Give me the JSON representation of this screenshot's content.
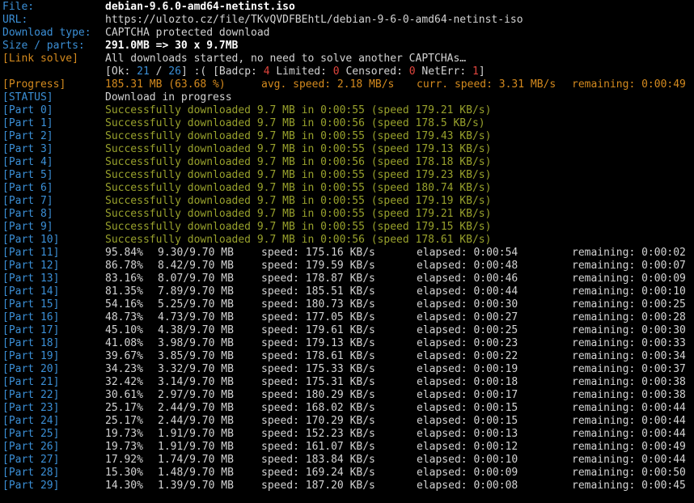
{
  "info": {
    "file_label": "File:",
    "file_value": "debian-9.6.0-amd64-netinst.iso",
    "url_label": "URL:",
    "url_value": "https://ulozto.cz/file/TKvQVDFBEhtL/debian-9-6-0-amd64-netinst-iso",
    "type_label": "Download type:",
    "type_value": "CAPTCHA protected download",
    "size_label": "Size / parts:",
    "size_value": "291.0MB => 30 x 9.7MB",
    "link_label": "[Link solve]",
    "link_value": "All downloads started, no need to solve another CAPTCHAs…"
  },
  "stats": {
    "open": "[Ok: ",
    "ok": "21",
    "slash": " / ",
    "total": "26",
    "sad": "] :( [Badcp: ",
    "badcp": "4",
    "limited_label": " Limited: ",
    "limited": "0",
    "censored_label": " Censored: ",
    "censored": "0",
    "neterr_label": " NetErr: ",
    "neterr": "1",
    "close": "]"
  },
  "progress": {
    "label": "[Progress]",
    "amount": "185.31 MB (63.68 %)",
    "avg": "avg. speed: 2.18 MB/s",
    "curr": "curr. speed: 3.31 MB/s",
    "remaining": "remaining: 0:00:49"
  },
  "status": {
    "label": "[STATUS]",
    "value": "Download in progress"
  },
  "done_parts": [
    {
      "label": "[Part 0]",
      "text": "Successfully downloaded 9.7 MB in 0:00:55 (speed 179.21 KB/s)"
    },
    {
      "label": "[Part 1]",
      "text": "Successfully downloaded 9.7 MB in 0:00:56 (speed 178.5 KB/s)"
    },
    {
      "label": "[Part 2]",
      "text": "Successfully downloaded 9.7 MB in 0:00:55 (speed 179.43 KB/s)"
    },
    {
      "label": "[Part 3]",
      "text": "Successfully downloaded 9.7 MB in 0:00:55 (speed 179.13 KB/s)"
    },
    {
      "label": "[Part 4]",
      "text": "Successfully downloaded 9.7 MB in 0:00:56 (speed 178.18 KB/s)"
    },
    {
      "label": "[Part 5]",
      "text": "Successfully downloaded 9.7 MB in 0:00:55 (speed 179.23 KB/s)"
    },
    {
      "label": "[Part 6]",
      "text": "Successfully downloaded 9.7 MB in 0:00:55 (speed 180.74 KB/s)"
    },
    {
      "label": "[Part 7]",
      "text": "Successfully downloaded 9.7 MB in 0:00:55 (speed 179.19 KB/s)"
    },
    {
      "label": "[Part 8]",
      "text": "Successfully downloaded 9.7 MB in 0:00:55 (speed 179.21 KB/s)"
    },
    {
      "label": "[Part 9]",
      "text": "Successfully downloaded 9.7 MB in 0:00:55 (speed 179.15 KB/s)"
    },
    {
      "label": "[Part 10]",
      "text": "Successfully downloaded 9.7 MB in 0:00:56 (speed 178.61 KB/s)"
    }
  ],
  "active_parts": [
    {
      "label": "[Part 11]",
      "pct": "95.84%",
      "size": "9.30/9.70 MB",
      "speed": "speed: 175.16 KB/s",
      "elapsed": "elapsed: 0:00:54",
      "remaining": "remaining: 0:00:02"
    },
    {
      "label": "[Part 12]",
      "pct": "86.78%",
      "size": "8.42/9.70 MB",
      "speed": "speed: 179.59 KB/s",
      "elapsed": "elapsed: 0:00:48",
      "remaining": "remaining: 0:00:07"
    },
    {
      "label": "[Part 13]",
      "pct": "83.16%",
      "size": "8.07/9.70 MB",
      "speed": "speed: 178.87 KB/s",
      "elapsed": "elapsed: 0:00:46",
      "remaining": "remaining: 0:00:09"
    },
    {
      "label": "[Part 14]",
      "pct": "81.35%",
      "size": "7.89/9.70 MB",
      "speed": "speed: 185.51 KB/s",
      "elapsed": "elapsed: 0:00:44",
      "remaining": "remaining: 0:00:10"
    },
    {
      "label": "[Part 15]",
      "pct": "54.16%",
      "size": "5.25/9.70 MB",
      "speed": "speed: 180.73 KB/s",
      "elapsed": "elapsed: 0:00:30",
      "remaining": "remaining: 0:00:25"
    },
    {
      "label": "[Part 16]",
      "pct": "48.73%",
      "size": "4.73/9.70 MB",
      "speed": "speed: 177.05 KB/s",
      "elapsed": "elapsed: 0:00:27",
      "remaining": "remaining: 0:00:28"
    },
    {
      "label": "[Part 17]",
      "pct": "45.10%",
      "size": "4.38/9.70 MB",
      "speed": "speed: 179.61 KB/s",
      "elapsed": "elapsed: 0:00:25",
      "remaining": "remaining: 0:00:30"
    },
    {
      "label": "[Part 18]",
      "pct": "41.08%",
      "size": "3.98/9.70 MB",
      "speed": "speed: 179.13 KB/s",
      "elapsed": "elapsed: 0:00:23",
      "remaining": "remaining: 0:00:33"
    },
    {
      "label": "[Part 19]",
      "pct": "39.67%",
      "size": "3.85/9.70 MB",
      "speed": "speed: 178.61 KB/s",
      "elapsed": "elapsed: 0:00:22",
      "remaining": "remaining: 0:00:34"
    },
    {
      "label": "[Part 20]",
      "pct": "34.23%",
      "size": "3.32/9.70 MB",
      "speed": "speed: 175.33 KB/s",
      "elapsed": "elapsed: 0:00:19",
      "remaining": "remaining: 0:00:37"
    },
    {
      "label": "[Part 21]",
      "pct": "32.42%",
      "size": "3.14/9.70 MB",
      "speed": "speed: 175.31 KB/s",
      "elapsed": "elapsed: 0:00:18",
      "remaining": "remaining: 0:00:38"
    },
    {
      "label": "[Part 22]",
      "pct": "30.61%",
      "size": "2.97/9.70 MB",
      "speed": "speed: 180.29 KB/s",
      "elapsed": "elapsed: 0:00:17",
      "remaining": "remaining: 0:00:38"
    },
    {
      "label": "[Part 23]",
      "pct": "25.17%",
      "size": "2.44/9.70 MB",
      "speed": "speed: 168.02 KB/s",
      "elapsed": "elapsed: 0:00:15",
      "remaining": "remaining: 0:00:44"
    },
    {
      "label": "[Part 24]",
      "pct": "25.17%",
      "size": "2.44/9.70 MB",
      "speed": "speed: 170.29 KB/s",
      "elapsed": "elapsed: 0:00:15",
      "remaining": "remaining: 0:00:44"
    },
    {
      "label": "[Part 25]",
      "pct": "19.73%",
      "size": "1.91/9.70 MB",
      "speed": "speed: 152.23 KB/s",
      "elapsed": "elapsed: 0:00:13",
      "remaining": "remaining: 0:00:44"
    },
    {
      "label": "[Part 26]",
      "pct": "19.73%",
      "size": "1.91/9.70 MB",
      "speed": "speed: 161.07 KB/s",
      "elapsed": "elapsed: 0:00:12",
      "remaining": "remaining: 0:00:49"
    },
    {
      "label": "[Part 27]",
      "pct": "17.92%",
      "size": "1.74/9.70 MB",
      "speed": "speed: 183.84 KB/s",
      "elapsed": "elapsed: 0:00:10",
      "remaining": "remaining: 0:00:44"
    },
    {
      "label": "[Part 28]",
      "pct": "15.30%",
      "size": "1.48/9.70 MB",
      "speed": "speed: 169.24 KB/s",
      "elapsed": "elapsed: 0:00:09",
      "remaining": "remaining: 0:00:50"
    },
    {
      "label": "[Part 29]",
      "pct": "14.30%",
      "size": "1.39/9.70 MB",
      "speed": "speed: 187.20 KB/s",
      "elapsed": "elapsed: 0:00:08",
      "remaining": "remaining: 0:00:45"
    }
  ],
  "colors": {
    "background": "#000000",
    "label_blue": "#3b8fd6",
    "accent_orange": "#d48a1e",
    "success_olive": "#98a12c",
    "error_red": "#e0453d",
    "text": "#d3d3d3"
  }
}
